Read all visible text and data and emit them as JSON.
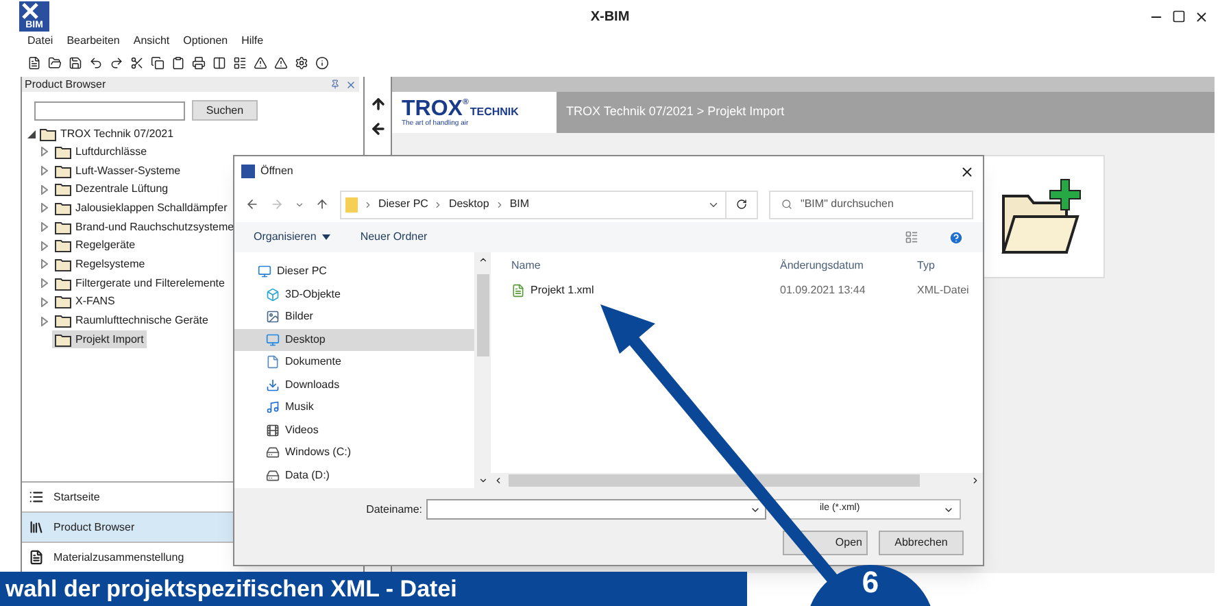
{
  "window": {
    "logo": "BIM",
    "title": "X-BIM"
  },
  "menu": [
    "Datei",
    "Bearbeiten",
    "Ansicht",
    "Optionen",
    "Hilfe"
  ],
  "panel": {
    "title": "Product Browser",
    "search": {
      "button": "Suchen"
    },
    "tree": {
      "label": "TROX Technik 07/2021",
      "expanded": true,
      "children": [
        {
          "label": "Luftdurchlässe",
          "expandable": true,
          "selected": false
        },
        {
          "label": "Luft-Wasser-Systeme",
          "expandable": true,
          "selected": false
        },
        {
          "label": "Dezentrale Lüftung",
          "expandable": true,
          "selected": false
        },
        {
          "label": "Jalousieklappen Schalldämpfer",
          "expandable": true,
          "selected": false
        },
        {
          "label": "Brand-und Rauchschutzsysteme",
          "expandable": true,
          "selected": false
        },
        {
          "label": "Regelgeräte",
          "expandable": true,
          "selected": false
        },
        {
          "label": "Regelsysteme",
          "expandable": true,
          "selected": false
        },
        {
          "label": "Filtergerate und Filterelemente",
          "expandable": true,
          "selected": false
        },
        {
          "label": "X-FANS",
          "expandable": true,
          "selected": false
        },
        {
          "label": "Raumlufttechnische Geräte",
          "expandable": true,
          "selected": false
        },
        {
          "label": "Projekt Import",
          "expandable": false,
          "selected": true
        }
      ]
    },
    "nav": [
      {
        "label": "Startseite",
        "kind": "list",
        "selected": false
      },
      {
        "label": "Product Browser",
        "kind": "books",
        "selected": true
      },
      {
        "label": "Materialzusammenstellung",
        "kind": "doc",
        "selected": false
      }
    ]
  },
  "header": {
    "brand": "TROX",
    "brand_mark": "®",
    "brand_suffix": "TECHNIK",
    "slogan": "The art of handling air",
    "breadcrumb": "TROX Technik 07/2021 > Projekt Import"
  },
  "dialog": {
    "title": "Öffnen",
    "path": [
      "Dieser PC",
      "Desktop",
      "BIM"
    ],
    "search": {
      "placeholder": "\"BIM\" durchsuchen"
    },
    "toolbar": [
      "Organisieren",
      "Neuer Ordner"
    ],
    "places": [
      {
        "label": "Dieser PC",
        "kind": "pc",
        "selected": false
      },
      {
        "label": "3D-Objekte",
        "kind": "cube",
        "selected": false
      },
      {
        "label": "Bilder",
        "kind": "pictures",
        "selected": false
      },
      {
        "label": "Desktop",
        "kind": "desktop",
        "selected": true
      },
      {
        "label": "Dokumente",
        "kind": "documents",
        "selected": false
      },
      {
        "label": "Downloads",
        "kind": "downloads",
        "selected": false
      },
      {
        "label": "Musik",
        "kind": "music",
        "selected": false
      },
      {
        "label": "Videos",
        "kind": "videos",
        "selected": false
      },
      {
        "label": "Windows (C:)",
        "kind": "drive",
        "selected": false
      },
      {
        "label": "Data (D:)",
        "kind": "drive",
        "selected": false
      }
    ],
    "columns": [
      "Name",
      "Änderungsdatum",
      "Typ"
    ],
    "rows": [
      [
        "Projekt 1.xml",
        "01.09.2021 13:44",
        "XML-Datei"
      ]
    ],
    "filename_label": "Dateiname:",
    "filter": "ile (*.xml)",
    "buttons": [
      "Open",
      "Abbrechen"
    ]
  },
  "callout": {
    "text": "wahl der projektspezifischen XML - Datei",
    "step": "6"
  }
}
